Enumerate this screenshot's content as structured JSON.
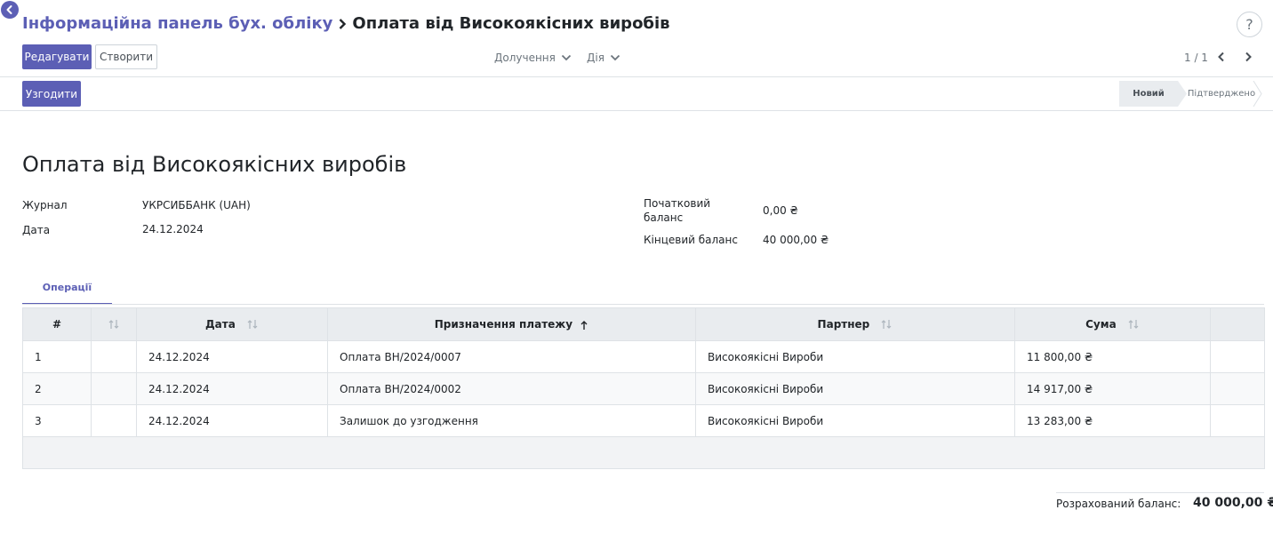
{
  "breadcrumb": {
    "parent": "Інформаційна панель бух. обліку",
    "current": "Оплата від Високоякісних виробів"
  },
  "help_label": "?",
  "toolbar": {
    "edit_label": "Редагувати",
    "create_label": "Створити",
    "attachments_label": "Долучення",
    "action_label": "Дія",
    "pager_label": "1 / 1"
  },
  "statusbar": {
    "reconcile_label": "Узгодити",
    "steps": [
      {
        "label": "Новий",
        "active": true
      },
      {
        "label": "Підтверджено",
        "active": false
      }
    ]
  },
  "form": {
    "title": "Оплата від Високоякісних виробів",
    "journal_label": "Журнал",
    "journal_value": "УКРСИББАНК (UAH)",
    "date_label": "Дата",
    "date_value": "24.12.2024",
    "start_balance_label_1": "Початковий",
    "start_balance_label_2": "баланс",
    "start_balance_value": "0,00 ₴",
    "end_balance_label": "Кінцевий баланс",
    "end_balance_value": "40 000,00 ₴"
  },
  "tabs": {
    "operations": "Операції"
  },
  "table": {
    "columns": {
      "num": "#",
      "date": "Дата",
      "label": "Призначення платежу",
      "partner": "Партнер",
      "amount": "Сума"
    },
    "rows": [
      {
        "num": "1",
        "date": "24.12.2024",
        "label": "Оплата ВН/2024/0007",
        "partner": "Високоякісні Вироби",
        "amount": "11 800,00 ₴"
      },
      {
        "num": "2",
        "date": "24.12.2024",
        "label": "Оплата ВН/2024/0002",
        "partner": "Високоякісні Вироби",
        "amount": "14 917,00 ₴"
      },
      {
        "num": "3",
        "date": "24.12.2024",
        "label": "Залишок до узгодження",
        "partner": "Високоякісні Вироби",
        "amount": "13 283,00 ₴"
      }
    ]
  },
  "summary": {
    "label": "Розрахований баланс:",
    "value": "40 000,00 ₴"
  },
  "colors": {
    "accent": "#5c5fb5",
    "header_bg": "#e9ecef",
    "border": "#dee2e6"
  }
}
